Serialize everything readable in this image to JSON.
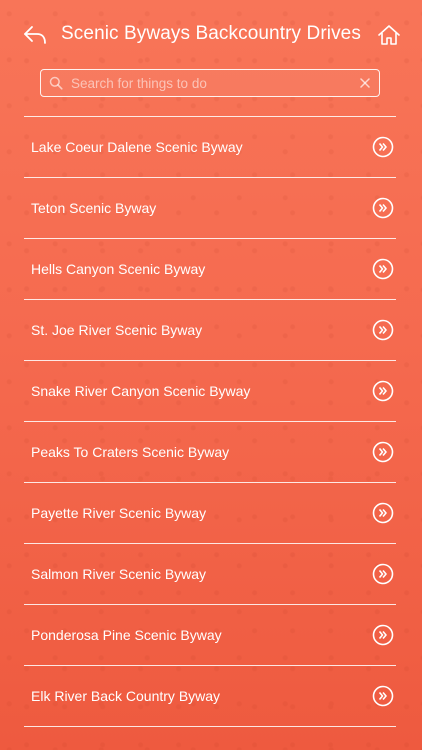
{
  "header": {
    "title": "Scenic Byways Backcountry Drives",
    "back_icon": "back-arrow-icon",
    "home_icon": "home-icon"
  },
  "search": {
    "placeholder": "Search for things to do",
    "value": ""
  },
  "list": {
    "items": [
      {
        "label": "Lake Coeur Dalene Scenic Byway"
      },
      {
        "label": "Teton Scenic Byway"
      },
      {
        "label": "Hells Canyon Scenic Byway"
      },
      {
        "label": "St. Joe River Scenic Byway"
      },
      {
        "label": "Snake River Canyon Scenic Byway"
      },
      {
        "label": "Peaks To Craters Scenic Byway"
      },
      {
        "label": "Payette River Scenic Byway"
      },
      {
        "label": "Salmon River Scenic Byway"
      },
      {
        "label": "Ponderosa Pine Scenic Byway"
      },
      {
        "label": "Elk River Back Country Byway"
      }
    ]
  },
  "colors": {
    "background": "#f56a4f",
    "text": "#ffffff"
  }
}
